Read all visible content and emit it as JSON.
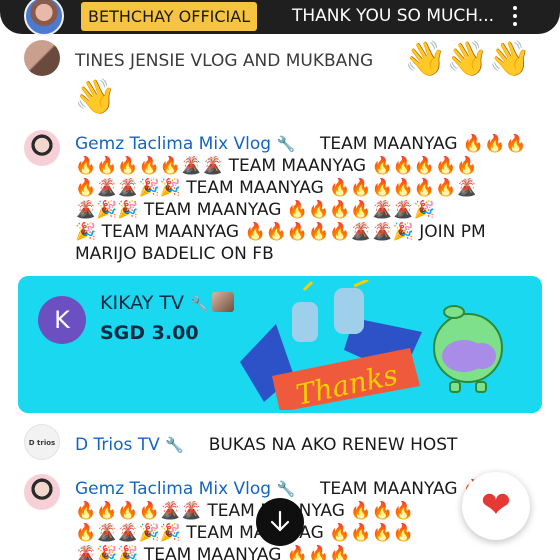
{
  "pinned": {
    "channel": "BETHCHAY OFFICIAL",
    "text": "THANK YOU SO MUCH..."
  },
  "messages": [
    {
      "author": "TINES JENSIE VLOG AND MUKBANG",
      "reaction": "👋👋👋",
      "reaction_line2": "👋"
    },
    {
      "author": "Gemz Taclima Mix Vlog",
      "wrench": "🔧",
      "lines": [
        "TEAM MAANYAG 🔥🔥🔥",
        "🔥🔥🔥🔥🔥🌋🌋 TEAM MAANYAG 🔥🔥🔥🔥🔥",
        "🔥🌋🌋🎉🎉 TEAM MAANYAG 🔥🔥🔥🔥🔥🔥🌋",
        "🌋🎉🎉 TEAM MAANYAG 🔥🔥🔥🔥🌋🌋🎉",
        "🎉 TEAM MAANYAG 🔥🔥🔥🔥🔥🌋🌋🎉 JOIN PM",
        "MARIJO BADELIC ON FB"
      ]
    },
    {
      "author": "D Trios TV",
      "avatar_text": "D trios TV",
      "wrench": "🔧",
      "text": "BUKAS NA AKO RENEW HOST"
    },
    {
      "author": "Gemz Taclima Mix Vlog",
      "wrench": "🔧",
      "lines": [
        "TEAM MAANYAG 🔥",
        "🔥🔥🔥🔥🌋🌋 TEAM MAANYAG 🔥🔥🔥",
        "🔥🌋🌋🎉🎉 TEAM MAANYAG 🔥🔥🔥🔥",
        "🌋🎉🎉 TEAM MAANYAG 🔥🔥🔥"
      ]
    }
  ],
  "superchat": {
    "author": "KIKAY TV",
    "avatar_letter": "K",
    "amount": "SGD 3.00",
    "sticker_text": "Thanks",
    "bg_color": "#1ad8ef"
  },
  "controls": {
    "heart_icon": "❤",
    "scroll_icon": "arrow-down-icon"
  }
}
